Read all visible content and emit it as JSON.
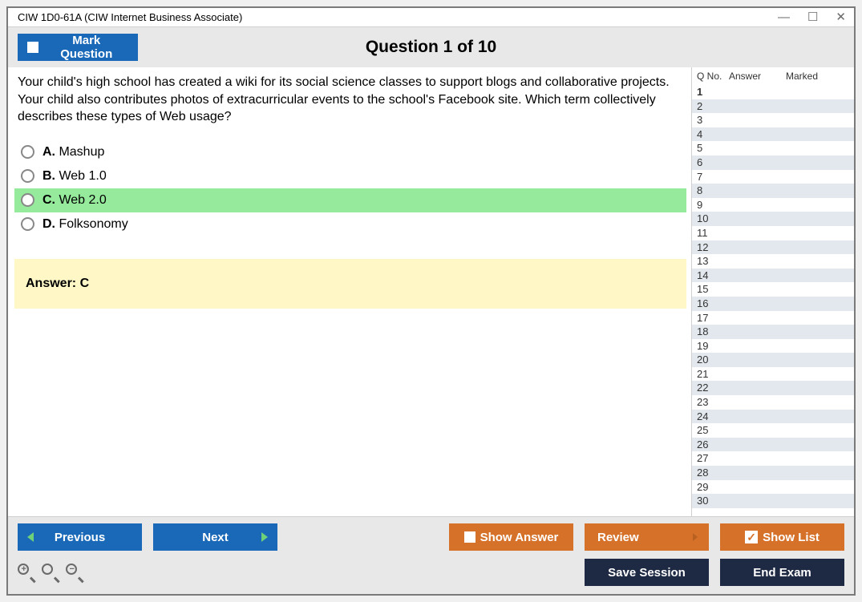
{
  "titlebar": {
    "title": "CIW 1D0-61A (CIW Internet Business Associate)"
  },
  "toolbar": {
    "mark_label": "Mark Question",
    "question_header": "Question 1 of 10"
  },
  "question": {
    "text": "Your child's high school has created a wiki for its social science classes to support blogs and collaborative projects. Your child also contributes photos of extracurricular events to the school's Facebook site. Which term collectively describes these types of Web usage?",
    "options": [
      {
        "letter": "A.",
        "text": "Mashup",
        "correct": false
      },
      {
        "letter": "B.",
        "text": "Web 1.0",
        "correct": false
      },
      {
        "letter": "C.",
        "text": "Web 2.0",
        "correct": true
      },
      {
        "letter": "D.",
        "text": "Folksonomy",
        "correct": false
      }
    ],
    "answer_label": "Answer: C"
  },
  "sidebar": {
    "headers": {
      "qno": "Q No.",
      "answer": "Answer",
      "marked": "Marked"
    },
    "total": 30,
    "current": 1
  },
  "bottom": {
    "previous": "Previous",
    "next": "Next",
    "show_answer": "Show Answer",
    "review": "Review",
    "show_list": "Show List",
    "save_session": "Save Session",
    "end_exam": "End Exam"
  }
}
